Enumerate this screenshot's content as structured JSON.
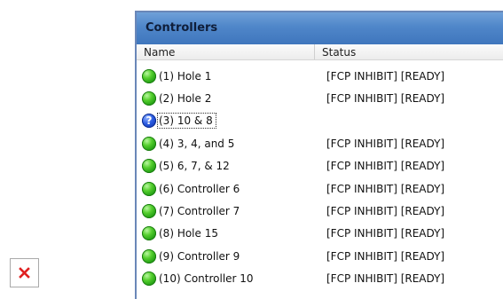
{
  "panel": {
    "title": "Controllers",
    "columns": {
      "name": "Name",
      "status": "Status"
    }
  },
  "controllers": [
    {
      "icon": "green-status-icon",
      "name": "(1)  Hole 1",
      "status": "[FCP INHIBIT] [READY]"
    },
    {
      "icon": "green-status-icon",
      "name": "(2)  Hole 2",
      "status": "[FCP INHIBIT] [READY]"
    },
    {
      "icon": "question-status-icon",
      "name": "(3)  10 & 8",
      "status": "",
      "selected": true
    },
    {
      "icon": "green-status-icon",
      "name": "(4)  3, 4, and 5",
      "status": "[FCP INHIBIT] [READY]"
    },
    {
      "icon": "green-status-icon",
      "name": "(5)  6, 7, & 12",
      "status": "[FCP INHIBIT] [READY]"
    },
    {
      "icon": "green-status-icon",
      "name": "(6)  Controller 6",
      "status": "[FCP INHIBIT] [READY]"
    },
    {
      "icon": "green-status-icon",
      "name": "(7)  Controller 7",
      "status": "[FCP INHIBIT] [READY]"
    },
    {
      "icon": "green-status-icon",
      "name": "(8)  Hole 15",
      "status": "[FCP INHIBIT] [READY]"
    },
    {
      "icon": "green-status-icon",
      "name": "(9)  Controller 9",
      "status": "[FCP INHIBIT] [READY]"
    },
    {
      "icon": "green-status-icon",
      "name": "(10)  Controller 10",
      "status": "[FCP INHIBIT] [READY]"
    }
  ],
  "icons": {
    "broken_image": "broken-image-icon",
    "question_glyph": "?"
  },
  "colors": {
    "title_bar": "#4f86c9",
    "status_ok": "#3cbf1e",
    "status_unknown": "#1f4fd6",
    "broken_image_x": "#e02020"
  }
}
